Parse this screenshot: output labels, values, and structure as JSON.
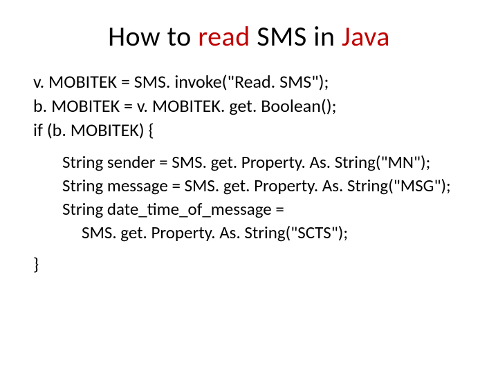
{
  "title": {
    "t1": "How to ",
    "kw1": "read",
    "t2": " SMS in ",
    "kw2": "Java"
  },
  "code": {
    "l1": "v. MOBITEK = SMS. invoke(\"Read. SMS\");",
    "l2": "b. MOBITEK = v. MOBITEK. get. Boolean();",
    "l3": "if (b. MOBITEK) {",
    "l4": "String sender = SMS. get. Property. As. String(\"MN\");",
    "l5": "String message = SMS. get. Property. As. String(\"MSG\");",
    "l6": "String date_time_of_message =",
    "l7": "SMS. get. Property. As. String(\"SCTS\");",
    "l8": "}"
  }
}
